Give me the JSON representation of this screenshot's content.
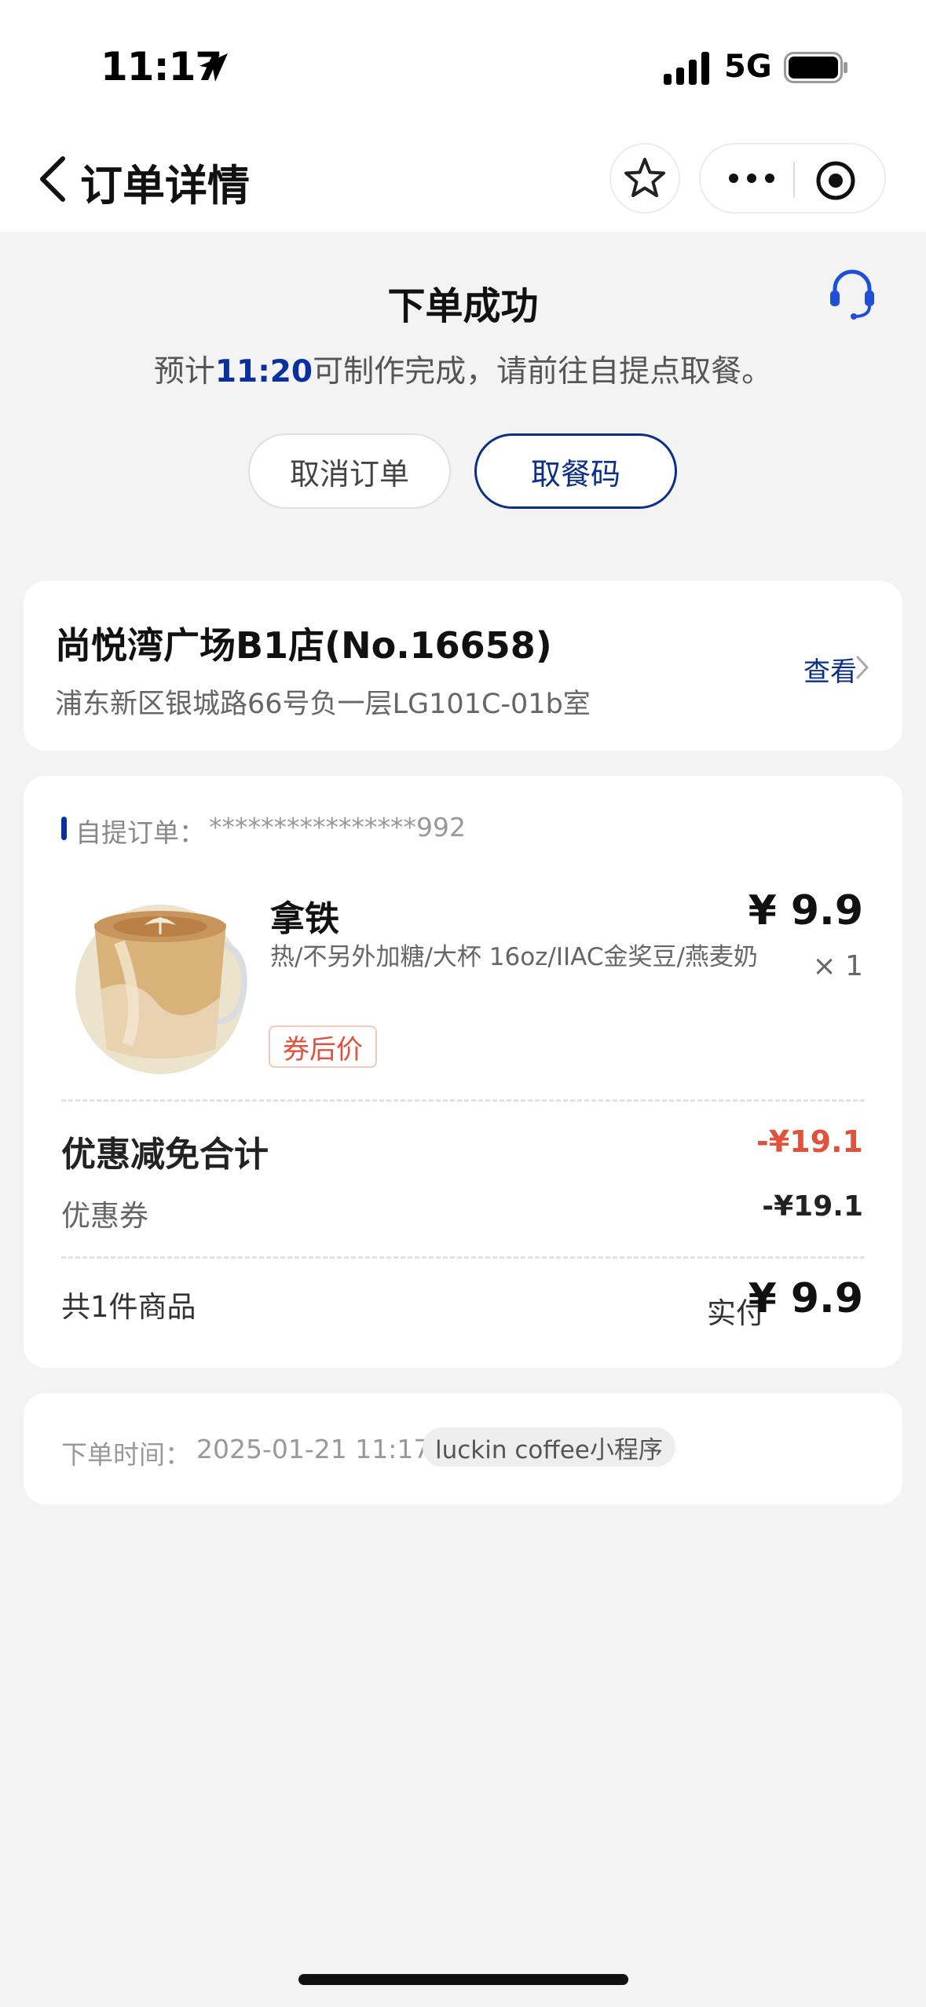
{
  "status_bar": {
    "time": "11:17",
    "network": "5G"
  },
  "nav": {
    "title": "订单详情"
  },
  "order_status": {
    "title": "下单成功",
    "eta_prefix": "预计",
    "eta_time": "11:20",
    "eta_suffix": "可制作完成，请前往自提点取餐。",
    "cancel_label": "取消订单",
    "pickup_code_label": "取餐码"
  },
  "store": {
    "name": "尚悦湾广场B1店(No.16658)",
    "address": "浦东新区银城路66号负一层LG101C-01b室",
    "view_label": "查看"
  },
  "order": {
    "type_label": "自提订单：",
    "number": "****************992",
    "product": {
      "name": "拿铁",
      "description": "热/不另外加糖/大杯 16oz/IIAC金奖豆/燕麦奶",
      "tag": "券后价",
      "price": "¥ 9.9",
      "quantity": "× 1"
    },
    "discount_title": "优惠减免合计",
    "discount_total": "-¥19.1",
    "coupon_label": "优惠券",
    "coupon_amount": "-¥19.1",
    "items_count": "共1件商品",
    "paid_label": "实付",
    "paid_amount": "¥ 9.9"
  },
  "order_info": {
    "time_label": "下单时间：",
    "time_value": "2025-01-21 11:17",
    "source": "luckin coffee小程序"
  },
  "colors": {
    "brand": "#0a2f8a",
    "accent_red": "#e2513b"
  },
  "icons": [
    "location-arrow-icon",
    "signal-icon",
    "battery-icon",
    "back-chevron-icon",
    "star-icon",
    "more-dots-icon",
    "target-icon",
    "headset-icon",
    "chevron-right-icon"
  ]
}
